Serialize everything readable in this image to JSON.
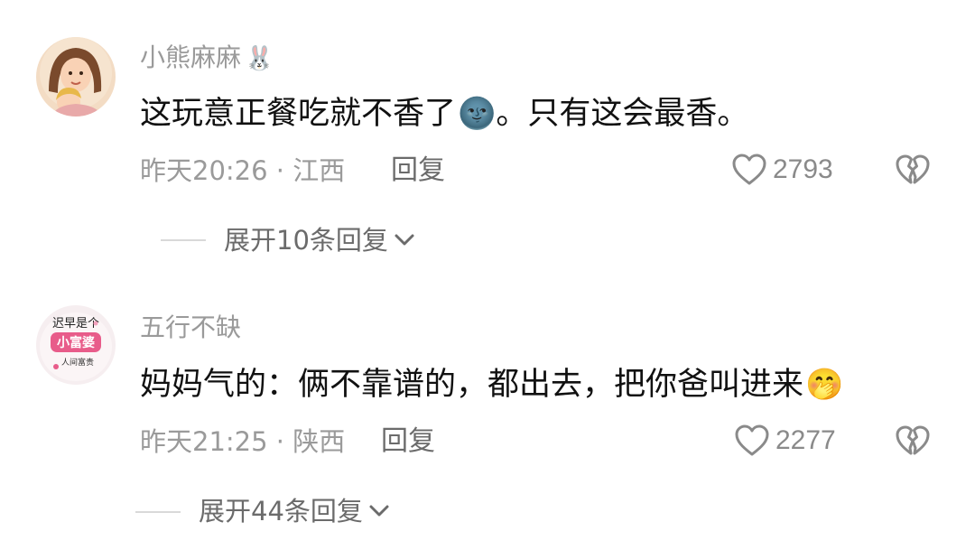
{
  "comments": [
    {
      "username": "小熊麻麻",
      "username_emoji": "🐰",
      "text": "这玩意正餐吃就不香了",
      "text_emoji": "🌚",
      "text_after": "。只有这会最香。",
      "meta": "昨天20:26 · 江西",
      "reply_label": "回复",
      "likes": "2793",
      "expand_label": "展开10条回复"
    },
    {
      "username": "五行不缺",
      "avatar_text": [
        "迟早是个",
        "小富婆",
        "人间富贵"
      ],
      "text": "妈妈气的：俩不靠谱的，都出去，把你爸叫进来",
      "text_emoji": "🤭",
      "meta": "昨天21:25 · 陕西",
      "reply_label": "回复",
      "likes": "2277",
      "expand_label": "展开44条回复"
    }
  ],
  "colors": {
    "username": "#9a9a9a",
    "text": "#111111",
    "meta": "#9a9a9a",
    "action": "#6b6b6b"
  }
}
